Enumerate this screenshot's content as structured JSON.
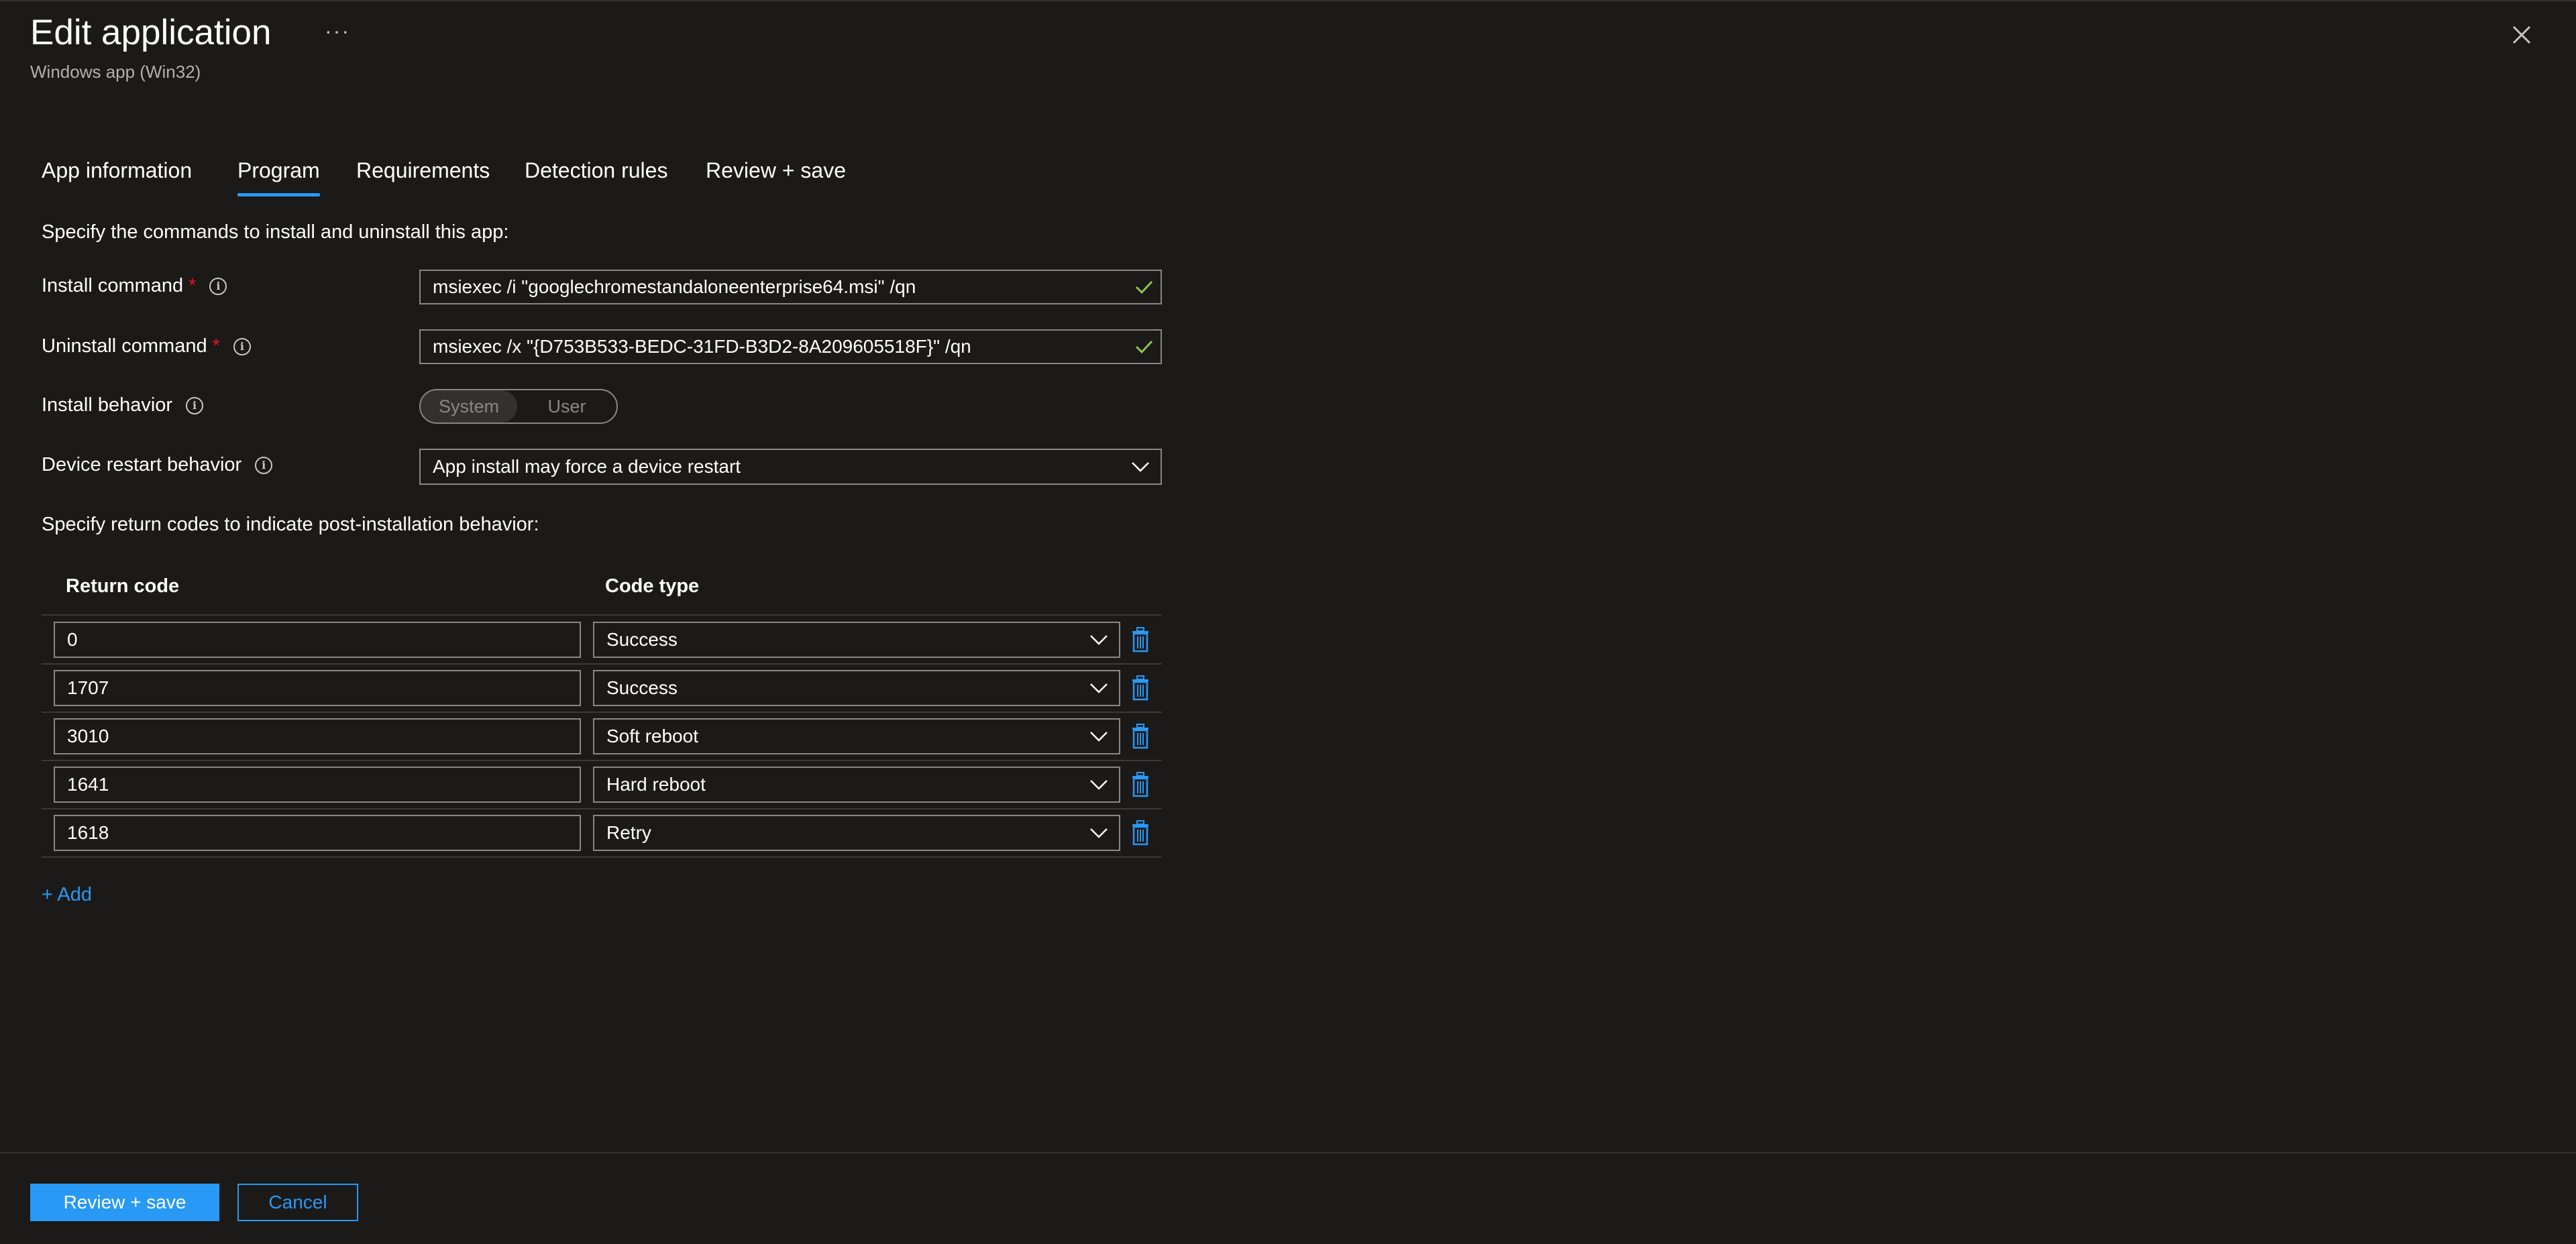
{
  "header": {
    "title": "Edit application",
    "subtitle": "Windows app (Win32)",
    "more_label": "···"
  },
  "tabs": [
    {
      "label": "App information"
    },
    {
      "label": "Program"
    },
    {
      "label": "Requirements"
    },
    {
      "label": "Detection rules"
    },
    {
      "label": "Review + save"
    }
  ],
  "active_tab": "Program",
  "program": {
    "intro": "Specify the commands to install and uninstall this app:",
    "install_command": {
      "label": "Install command",
      "required_mark": "*",
      "value": "msiexec /i \"googlechromestandaloneenterprise64.msi\" /qn"
    },
    "uninstall_command": {
      "label": "Uninstall command",
      "required_mark": "*",
      "value": "msiexec /x \"{D753B533-BEDC-31FD-B3D2-8A209605518F}\" /qn"
    },
    "install_behavior": {
      "label": "Install behavior",
      "options": [
        "System",
        "User"
      ],
      "selected": "System"
    },
    "device_restart": {
      "label": "Device restart behavior",
      "value": "App install may force a device restart"
    },
    "return_intro": "Specify return codes to indicate post-installation behavior:"
  },
  "return_codes": {
    "headers": {
      "code": "Return code",
      "type": "Code type"
    },
    "rows": [
      {
        "code": "0",
        "type": "Success"
      },
      {
        "code": "1707",
        "type": "Success"
      },
      {
        "code": "3010",
        "type": "Soft reboot"
      },
      {
        "code": "1641",
        "type": "Hard reboot"
      },
      {
        "code": "1618",
        "type": "Retry"
      }
    ],
    "add_label": "+ Add"
  },
  "footer": {
    "primary_label": "Review + save",
    "cancel_label": "Cancel"
  },
  "colors": {
    "background": "#1b1a19",
    "accent": "#2899f5",
    "required": "#e81123",
    "valid_check": "#92c353",
    "border": "#8a8886"
  }
}
